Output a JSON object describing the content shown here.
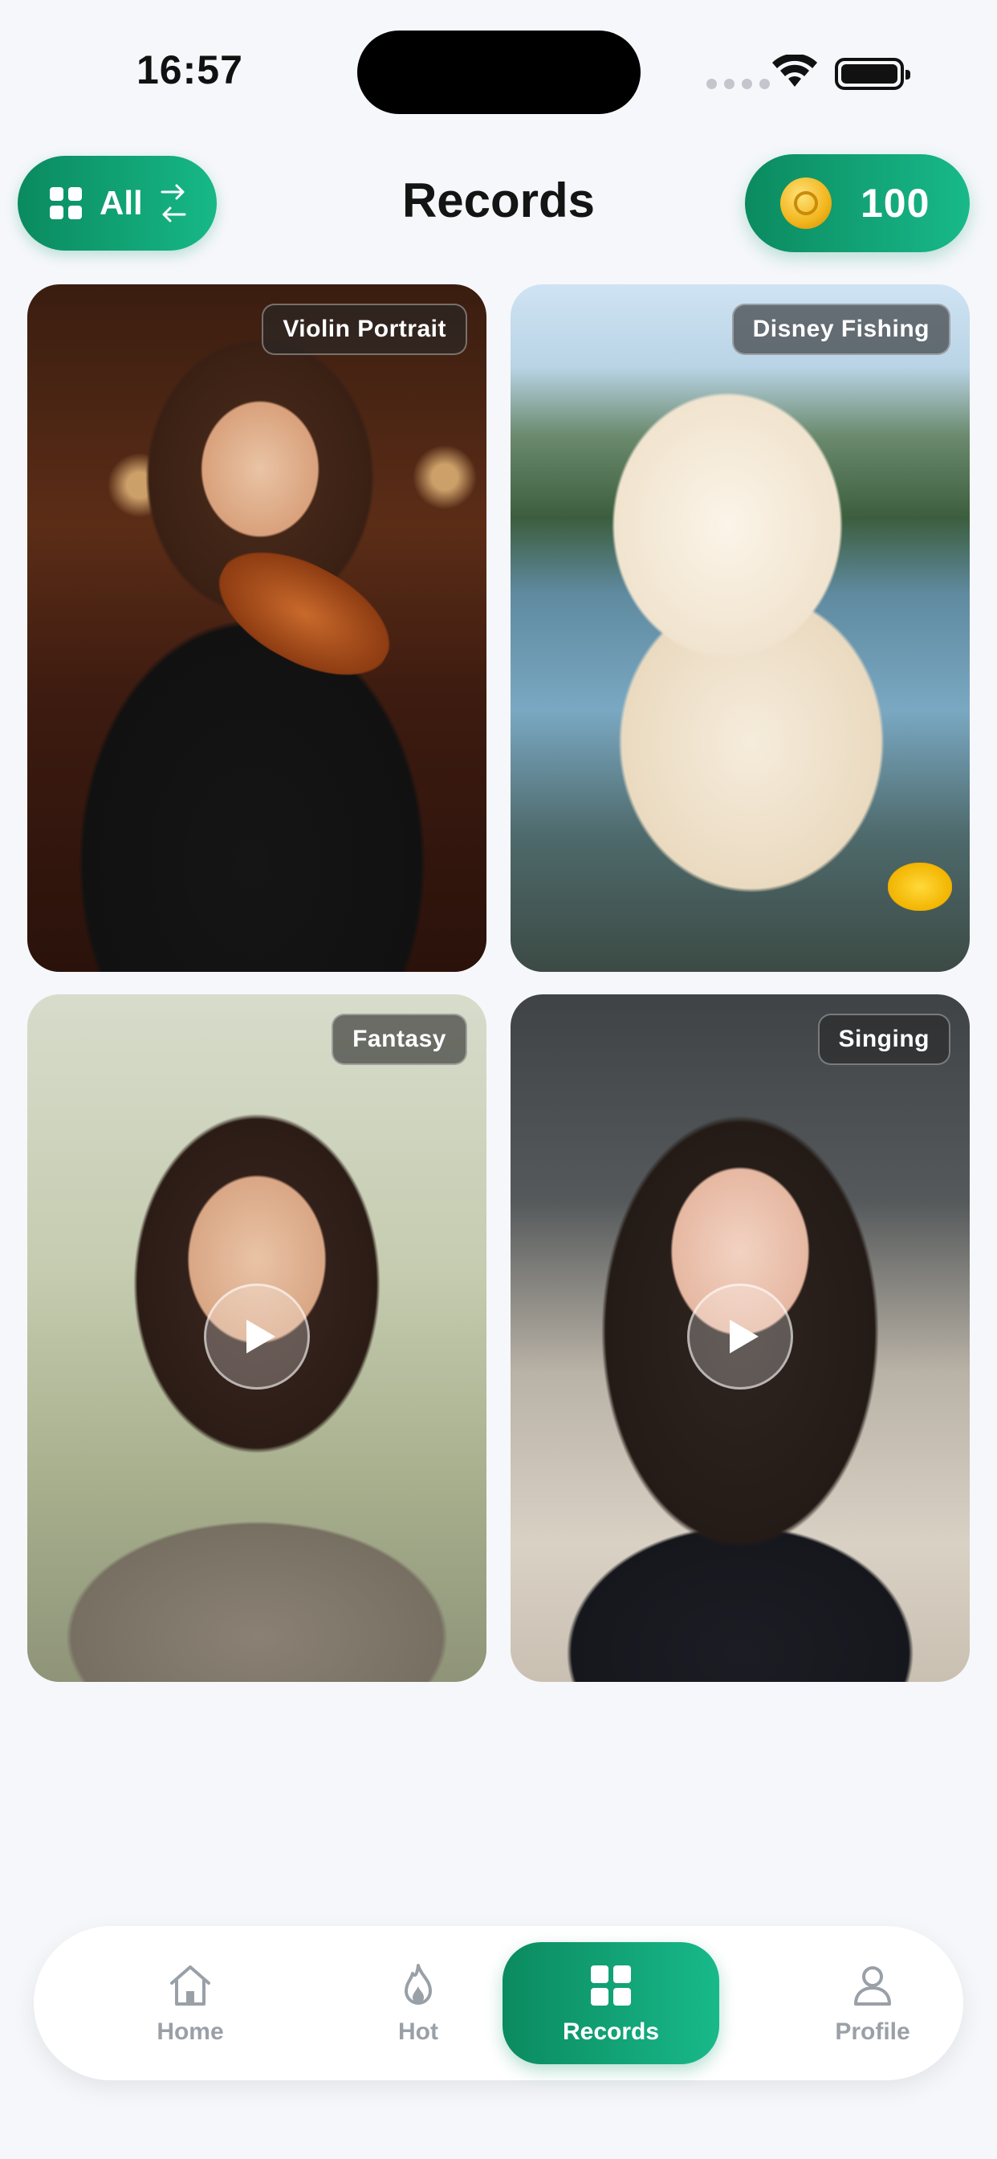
{
  "status_bar": {
    "time": "16:57"
  },
  "header": {
    "filter_label": "All",
    "title": "Records",
    "coins": "100"
  },
  "records": [
    {
      "tag": "Violin Portrait",
      "media": "image"
    },
    {
      "tag": "Disney Fishing",
      "media": "image"
    },
    {
      "tag": "Fantasy",
      "media": "video"
    },
    {
      "tag": "Singing",
      "media": "video"
    }
  ],
  "bottom_nav": [
    {
      "label": "Home",
      "icon": "home-icon",
      "active": false
    },
    {
      "label": "Hot",
      "icon": "flame-icon",
      "active": false
    },
    {
      "label": "Records",
      "icon": "grid-icon",
      "active": true
    },
    {
      "label": "Profile",
      "icon": "person-icon",
      "active": false
    }
  ],
  "colors": {
    "accent_start": "#0b8a5f",
    "accent_end": "#18b98a",
    "background": "#f5f7fa"
  }
}
